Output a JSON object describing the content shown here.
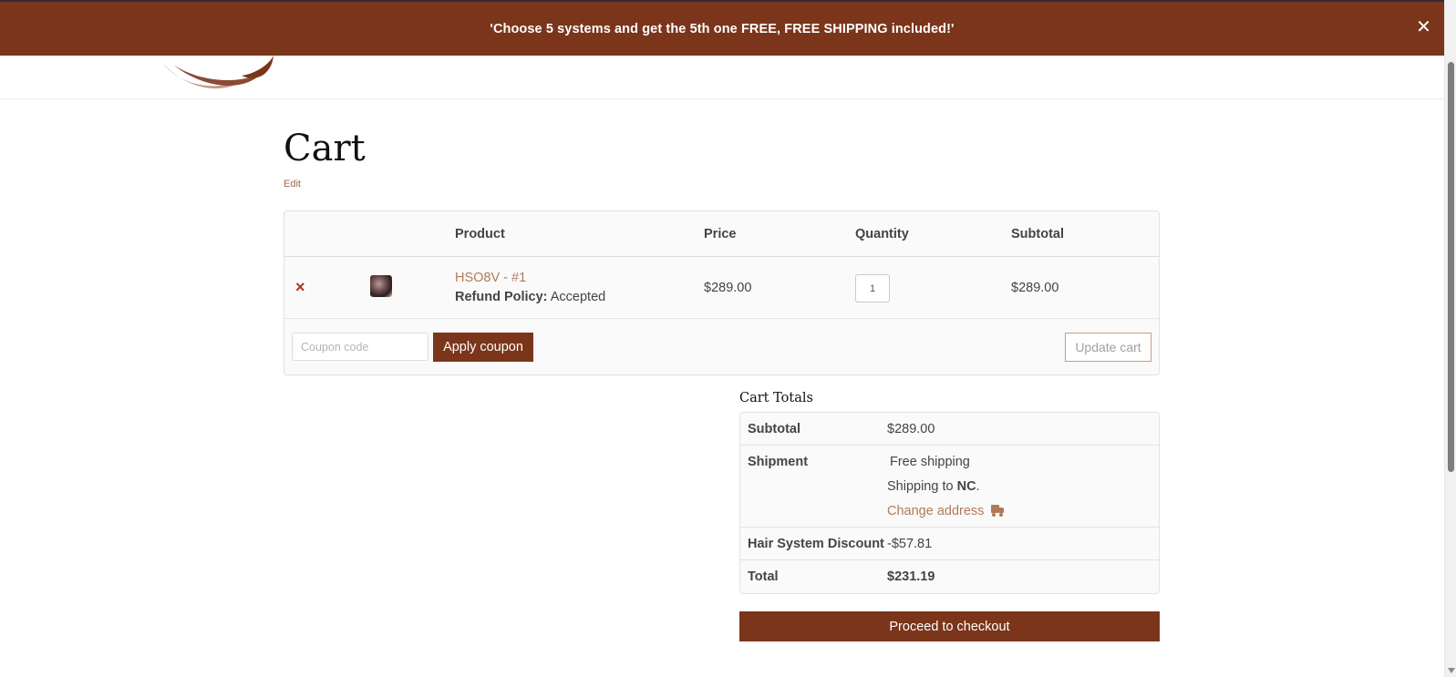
{
  "promo": {
    "text": "'Choose 5 systems and get the 5th one FREE, FREE SHIPPING included!'",
    "close_icon": "✕"
  },
  "page": {
    "title": "Cart",
    "edit_label": "Edit"
  },
  "cart": {
    "headers": {
      "product": "Product",
      "price": "Price",
      "quantity": "Quantity",
      "subtotal": "Subtotal"
    },
    "items": [
      {
        "remove_icon": "×",
        "name": "HSO8V - #1",
        "meta_label": "Refund Policy:",
        "meta_value": "Accepted",
        "price": "$289.00",
        "quantity": "1",
        "subtotal": "$289.00"
      }
    ],
    "coupon_placeholder": "Coupon code",
    "apply_coupon_label": "Apply coupon",
    "update_cart_label": "Update cart"
  },
  "totals": {
    "title": "Cart Totals",
    "subtotal_label": "Subtotal",
    "subtotal_value": "$289.00",
    "shipment_label": "Shipment",
    "shipment_method": "Free shipping",
    "shipping_to_prefix": "Shipping to",
    "shipping_to_region": "NC",
    "change_address_label": "Change address",
    "discount_label": "Hair System Discount",
    "discount_value": "-$57.81",
    "total_label": "Total",
    "total_value": "$231.19"
  },
  "checkout_label": "Proceed to checkout",
  "colors": {
    "brand": "#7a351b",
    "link": "#b07a5a",
    "remove": "#b8311d"
  }
}
